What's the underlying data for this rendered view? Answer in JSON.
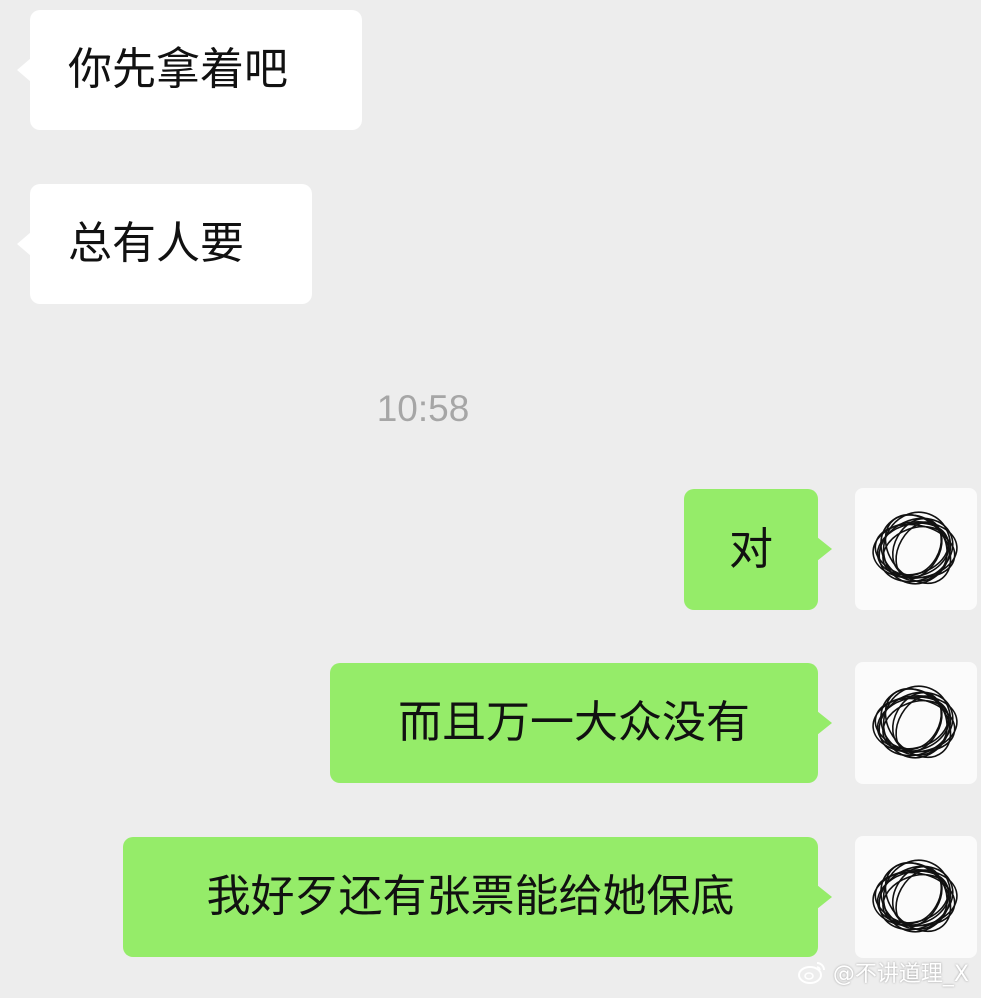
{
  "chat": {
    "messages": [
      {
        "direction": "incoming",
        "text": "你先拿着吧"
      },
      {
        "direction": "incoming",
        "text": "总有人要"
      },
      {
        "direction": "outgoing",
        "text": "对"
      },
      {
        "direction": "outgoing",
        "text": "而且万一大众没有"
      },
      {
        "direction": "outgoing",
        "text": "我好歹还有张票能给她保底"
      }
    ],
    "timestamp": "10:58"
  },
  "colors": {
    "background": "#ededed",
    "incoming_bubble": "#ffffff",
    "outgoing_bubble": "#95ec69",
    "timestamp_text": "#a6a6a6"
  },
  "icons": {
    "avatar": "scribble-avatar-icon",
    "watermark": "weibo-logo-icon"
  },
  "watermark": {
    "text": "@不讲道理_X"
  }
}
